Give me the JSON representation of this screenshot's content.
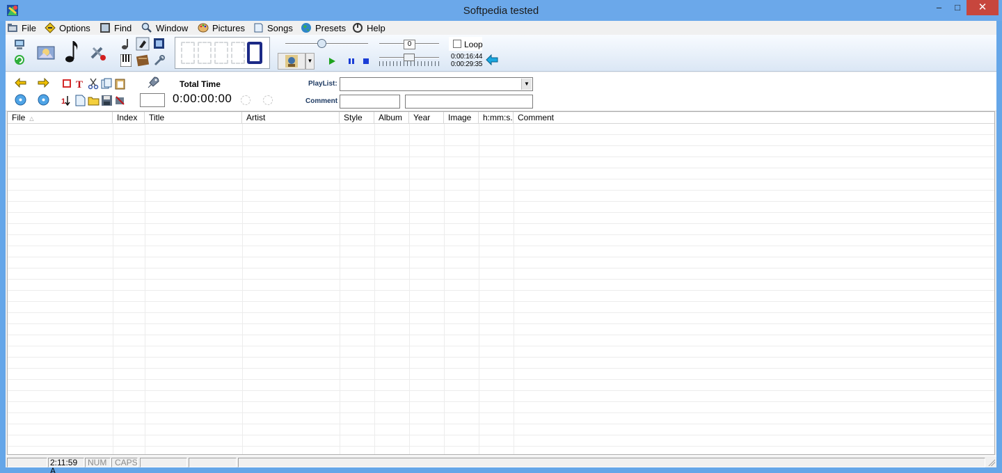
{
  "window": {
    "title": "Softpedia tested",
    "minimize_glyph": "–",
    "maximize_glyph": "□",
    "close_glyph": "✕"
  },
  "menu": [
    {
      "label": "File",
      "icon": "folder-icon"
    },
    {
      "label": "Options",
      "icon": "options-icon"
    },
    {
      "label": "Find",
      "icon": "find-icon"
    },
    {
      "label": "Window",
      "icon": "magnifier-icon"
    },
    {
      "label": "Pictures",
      "icon": "palette-icon"
    },
    {
      "label": "Songs",
      "icon": "songs-icon"
    },
    {
      "label": "Presets",
      "icon": "globe-icon"
    },
    {
      "label": "Help",
      "icon": "help-icon"
    }
  ],
  "player": {
    "volume_value": "0",
    "loop_label": "Loop",
    "elapsed": "0:00:16:44",
    "total": "0:00:29:35"
  },
  "playlist_panel": {
    "total_time_label": "Total Time",
    "total_time_value": "0:00:00:00",
    "playlist_label": "PlayList:",
    "comment_label": "Comment"
  },
  "list": {
    "columns": [
      "File",
      "Index",
      "Title",
      "Artist",
      "Style",
      "Album",
      "Year",
      "Image",
      "h:mm:s...",
      "Comment"
    ],
    "sort_glyph": "△",
    "rows": []
  },
  "status": {
    "clock": "2:11:59 A",
    "num": "NUM",
    "caps": "CAPS"
  },
  "colors": {
    "titlebar": "#6ba8ea",
    "close_button": "#c7463d",
    "led_digit": "#1c2a86",
    "play_green": "#1ea31e",
    "control_blue": "#1a3dd6",
    "back_arrow": "#1aa7e0"
  }
}
